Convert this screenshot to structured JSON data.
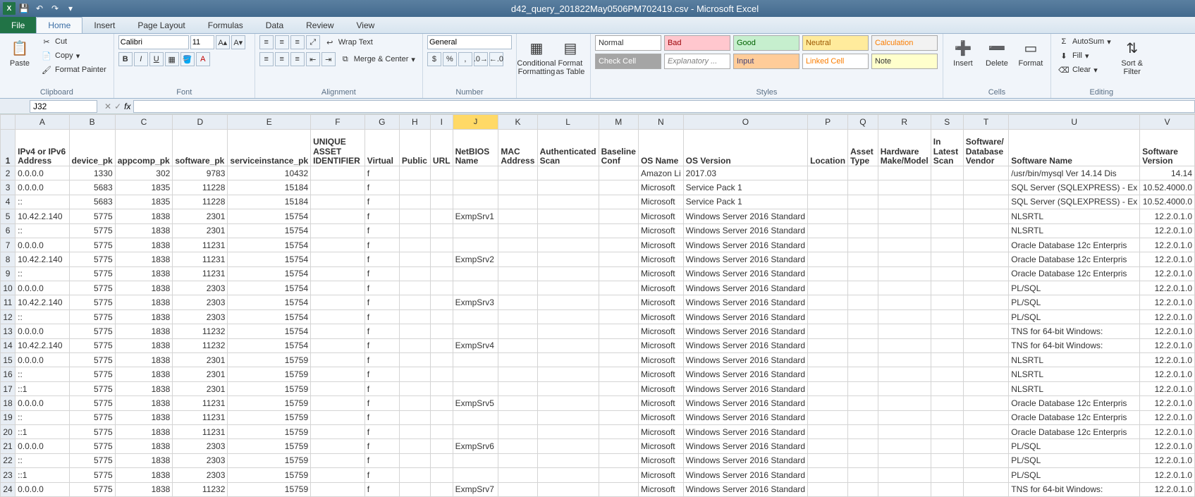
{
  "titlebar": {
    "title": "d42_query_201822May0506PM702419.csv - Microsoft Excel"
  },
  "tabs": {
    "file": "File",
    "t1": "Home",
    "t2": "Insert",
    "t3": "Page Layout",
    "t4": "Formulas",
    "t5": "Data",
    "t6": "Review",
    "t7": "View"
  },
  "clip": {
    "paste": "Paste",
    "cut": "Cut",
    "copy": "Copy",
    "fp": "Format Painter",
    "label": "Clipboard"
  },
  "font": {
    "name": "Calibri",
    "size": "11",
    "label": "Font"
  },
  "align": {
    "wrap": "Wrap Text",
    "merge": "Merge & Center",
    "label": "Alignment"
  },
  "number": {
    "fmt": "General",
    "label": "Number"
  },
  "cond": {
    "cf": "Conditional\nFormatting",
    "fat": "Format\nas Table"
  },
  "styles": {
    "normal": "Normal",
    "bad": "Bad",
    "good": "Good",
    "neutral": "Neutral",
    "calc": "Calculation",
    "check": "Check Cell",
    "explan": "Explanatory ...",
    "input": "Input",
    "linked": "Linked Cell",
    "note": "Note",
    "label": "Styles"
  },
  "cells": {
    "insert": "Insert",
    "delete": "Delete",
    "format": "Format",
    "label": "Cells"
  },
  "editing": {
    "autosum": "AutoSum",
    "fill": "Fill",
    "clear": "Clear",
    "sort": "Sort &\nFilter",
    "label": "Editing"
  },
  "namebox": "J32",
  "cols": {
    "A": "IPv4 or IPv6 Address",
    "B": "device_pk",
    "C": "appcomp_pk",
    "D": "software_pk",
    "E": "serviceinstance_pk",
    "F": "UNIQUE ASSET IDENTIFIER",
    "G": "Virtual",
    "H": "Public",
    "I": "URL",
    "J": "NetBIOS Name",
    "K": "MAC Address",
    "L": "Authenticated Scan",
    "M": "Baseline Conf",
    "N": "OS Name",
    "O": "OS Version",
    "P": "Location",
    "Q": "Asset Type",
    "R": "Hardware Make/Model",
    "S": "In Latest Scan",
    "T": "Software/ Database Vendor",
    "U": "Software Name",
    "V": "Software Version"
  },
  "chart_data": {
    "type": "table",
    "columns": [
      "IPv4 or IPv6 Address",
      "device_pk",
      "appcomp_pk",
      "software_pk",
      "serviceinstance_pk",
      "UNIQUE ASSET IDENTIFIER",
      "Virtual",
      "Public",
      "URL",
      "NetBIOS Name",
      "MAC Address",
      "Authenticated Scan",
      "Baseline Conf",
      "OS Name",
      "OS Version",
      "Location",
      "Asset Type",
      "Hardware Make/Model",
      "In Latest Scan",
      "Software/ Database Vendor",
      "Software Name",
      "Software Version"
    ],
    "rows": [
      [
        "0.0.0.0",
        "1330",
        "302",
        "9783",
        "10432",
        "",
        "f",
        "",
        "",
        "",
        "",
        "",
        "",
        "Amazon Li",
        "2017.03",
        "",
        "",
        "",
        "",
        "",
        "/usr/bin/mysql  Ver 14.14 Dis",
        "14.14"
      ],
      [
        "0.0.0.0",
        "5683",
        "1835",
        "11228",
        "15184",
        "",
        "f",
        "",
        "",
        "",
        "",
        "",
        "",
        "Microsoft",
        "Service Pack 1",
        "",
        "",
        "",
        "",
        "",
        "SQL Server (SQLEXPRESS) - Ex",
        "10.52.4000.0"
      ],
      [
        "::",
        "5683",
        "1835",
        "11228",
        "15184",
        "",
        "f",
        "",
        "",
        "",
        "",
        "",
        "",
        "Microsoft",
        "Service Pack 1",
        "",
        "",
        "",
        "",
        "",
        "SQL Server (SQLEXPRESS) - Ex",
        "10.52.4000.0"
      ],
      [
        "10.42.2.140",
        "5775",
        "1838",
        "2301",
        "15754",
        "",
        "f",
        "",
        "",
        "ExmpSrv1",
        "",
        "",
        "",
        "Microsoft",
        "Windows Server 2016 Standard",
        "",
        "",
        "",
        "",
        "",
        "NLSRTL",
        "12.2.0.1.0"
      ],
      [
        "::",
        "5775",
        "1838",
        "2301",
        "15754",
        "",
        "f",
        "",
        "",
        "",
        "",
        "",
        "",
        "Microsoft",
        "Windows Server 2016 Standard",
        "",
        "",
        "",
        "",
        "",
        "NLSRTL",
        "12.2.0.1.0"
      ],
      [
        "0.0.0.0",
        "5775",
        "1838",
        "11231",
        "15754",
        "",
        "f",
        "",
        "",
        "",
        "",
        "",
        "",
        "Microsoft",
        "Windows Server 2016 Standard",
        "",
        "",
        "",
        "",
        "",
        "Oracle Database 12c Enterpris",
        "12.2.0.1.0"
      ],
      [
        "10.42.2.140",
        "5775",
        "1838",
        "11231",
        "15754",
        "",
        "f",
        "",
        "",
        "ExmpSrv2",
        "",
        "",
        "",
        "Microsoft",
        "Windows Server 2016 Standard",
        "",
        "",
        "",
        "",
        "",
        "Oracle Database 12c Enterpris",
        "12.2.0.1.0"
      ],
      [
        "::",
        "5775",
        "1838",
        "11231",
        "15754",
        "",
        "f",
        "",
        "",
        "",
        "",
        "",
        "",
        "Microsoft",
        "Windows Server 2016 Standard",
        "",
        "",
        "",
        "",
        "",
        "Oracle Database 12c Enterpris",
        "12.2.0.1.0"
      ],
      [
        "0.0.0.0",
        "5775",
        "1838",
        "2303",
        "15754",
        "",
        "f",
        "",
        "",
        "",
        "",
        "",
        "",
        "Microsoft",
        "Windows Server 2016 Standard",
        "",
        "",
        "",
        "",
        "",
        "PL/SQL",
        "12.2.0.1.0"
      ],
      [
        "10.42.2.140",
        "5775",
        "1838",
        "2303",
        "15754",
        "",
        "f",
        "",
        "",
        "ExmpSrv3",
        "",
        "",
        "",
        "Microsoft",
        "Windows Server 2016 Standard",
        "",
        "",
        "",
        "",
        "",
        "PL/SQL",
        "12.2.0.1.0"
      ],
      [
        "::",
        "5775",
        "1838",
        "2303",
        "15754",
        "",
        "f",
        "",
        "",
        "",
        "",
        "",
        "",
        "Microsoft",
        "Windows Server 2016 Standard",
        "",
        "",
        "",
        "",
        "",
        "PL/SQL",
        "12.2.0.1.0"
      ],
      [
        "0.0.0.0",
        "5775",
        "1838",
        "11232",
        "15754",
        "",
        "f",
        "",
        "",
        "",
        "",
        "",
        "",
        "Microsoft",
        "Windows Server 2016 Standard",
        "",
        "",
        "",
        "",
        "",
        "TNS for 64-bit Windows:",
        "12.2.0.1.0"
      ],
      [
        "10.42.2.140",
        "5775",
        "1838",
        "11232",
        "15754",
        "",
        "f",
        "",
        "",
        "ExmpSrv4",
        "",
        "",
        "",
        "Microsoft",
        "Windows Server 2016 Standard",
        "",
        "",
        "",
        "",
        "",
        "TNS for 64-bit Windows:",
        "12.2.0.1.0"
      ],
      [
        "0.0.0.0",
        "5775",
        "1838",
        "2301",
        "15759",
        "",
        "f",
        "",
        "",
        "",
        "",
        "",
        "",
        "Microsoft",
        "Windows Server 2016 Standard",
        "",
        "",
        "",
        "",
        "",
        "NLSRTL",
        "12.2.0.1.0"
      ],
      [
        "::",
        "5775",
        "1838",
        "2301",
        "15759",
        "",
        "f",
        "",
        "",
        "",
        "",
        "",
        "",
        "Microsoft",
        "Windows Server 2016 Standard",
        "",
        "",
        "",
        "",
        "",
        "NLSRTL",
        "12.2.0.1.0"
      ],
      [
        "::1",
        "5775",
        "1838",
        "2301",
        "15759",
        "",
        "f",
        "",
        "",
        "",
        "",
        "",
        "",
        "Microsoft",
        "Windows Server 2016 Standard",
        "",
        "",
        "",
        "",
        "",
        "NLSRTL",
        "12.2.0.1.0"
      ],
      [
        "0.0.0.0",
        "5775",
        "1838",
        "11231",
        "15759",
        "",
        "f",
        "",
        "",
        "ExmpSrv5",
        "",
        "",
        "",
        "Microsoft",
        "Windows Server 2016 Standard",
        "",
        "",
        "",
        "",
        "",
        "Oracle Database 12c Enterpris",
        "12.2.0.1.0"
      ],
      [
        "::",
        "5775",
        "1838",
        "11231",
        "15759",
        "",
        "f",
        "",
        "",
        "",
        "",
        "",
        "",
        "Microsoft",
        "Windows Server 2016 Standard",
        "",
        "",
        "",
        "",
        "",
        "Oracle Database 12c Enterpris",
        "12.2.0.1.0"
      ],
      [
        "::1",
        "5775",
        "1838",
        "11231",
        "15759",
        "",
        "f",
        "",
        "",
        "",
        "",
        "",
        "",
        "Microsoft",
        "Windows Server 2016 Standard",
        "",
        "",
        "",
        "",
        "",
        "Oracle Database 12c Enterpris",
        "12.2.0.1.0"
      ],
      [
        "0.0.0.0",
        "5775",
        "1838",
        "2303",
        "15759",
        "",
        "f",
        "",
        "",
        "ExmpSrv6",
        "",
        "",
        "",
        "Microsoft",
        "Windows Server 2016 Standard",
        "",
        "",
        "",
        "",
        "",
        "PL/SQL",
        "12.2.0.1.0"
      ],
      [
        "::",
        "5775",
        "1838",
        "2303",
        "15759",
        "",
        "f",
        "",
        "",
        "",
        "",
        "",
        "",
        "Microsoft",
        "Windows Server 2016 Standard",
        "",
        "",
        "",
        "",
        "",
        "PL/SQL",
        "12.2.0.1.0"
      ],
      [
        "::1",
        "5775",
        "1838",
        "2303",
        "15759",
        "",
        "f",
        "",
        "",
        "",
        "",
        "",
        "",
        "Microsoft",
        "Windows Server 2016 Standard",
        "",
        "",
        "",
        "",
        "",
        "PL/SQL",
        "12.2.0.1.0"
      ],
      [
        "0.0.0.0",
        "5775",
        "1838",
        "11232",
        "15759",
        "",
        "f",
        "",
        "",
        "ExmpSrv7",
        "",
        "",
        "",
        "Microsoft",
        "Windows Server 2016 Standard",
        "",
        "",
        "",
        "",
        "",
        "TNS for 64-bit Windows:",
        "12.2.0.1.0"
      ]
    ]
  },
  "colWidths": {
    "A": 100,
    "B": 60,
    "C": 84,
    "D": 82,
    "E": 116,
    "F": 88,
    "G": 68,
    "H": 48,
    "I": 26,
    "J": 74,
    "K": 56,
    "L": 44,
    "M": 36,
    "N": 58,
    "O": 62,
    "P": 54,
    "Q": 54,
    "R": 54,
    "S": 60,
    "T": 78,
    "U": 166,
    "V": 80
  }
}
